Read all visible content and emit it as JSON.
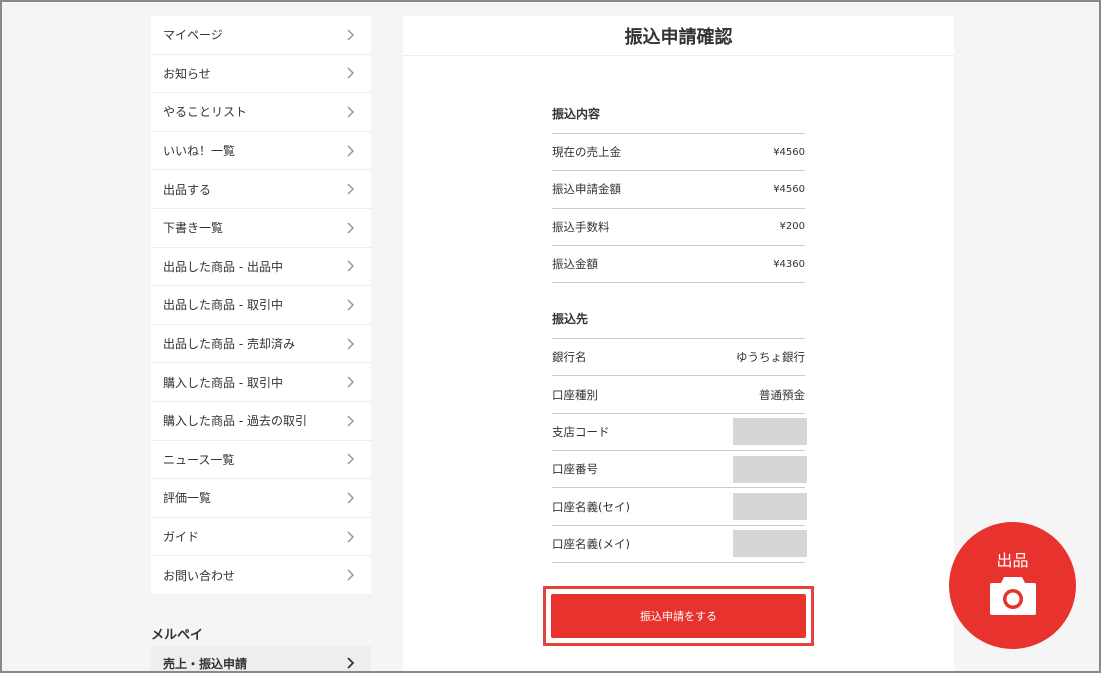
{
  "sidebar": {
    "items": [
      {
        "label": "マイページ"
      },
      {
        "label": "お知らせ"
      },
      {
        "label": "やることリスト"
      },
      {
        "label": "いいね！一覧"
      },
      {
        "label": "出品する"
      },
      {
        "label": "下書き一覧"
      },
      {
        "label": "出品した商品 - 出品中"
      },
      {
        "label": "出品した商品 - 取引中"
      },
      {
        "label": "出品した商品 - 売却済み"
      },
      {
        "label": "購入した商品 - 取引中"
      },
      {
        "label": "購入した商品 - 過去の取引"
      },
      {
        "label": "ニュース一覧"
      },
      {
        "label": "評価一覧"
      },
      {
        "label": "ガイド"
      },
      {
        "label": "お問い合わせ"
      }
    ],
    "section_title": "メルペイ",
    "active_item": "売上・振込申請"
  },
  "main": {
    "title": "振込申請確認",
    "transfer": {
      "heading": "振込内容",
      "rows": [
        {
          "label": "現在の売上金",
          "value": "¥4560"
        },
        {
          "label": "振込申請金額",
          "value": "¥4560"
        },
        {
          "label": "振込手数料",
          "value": "¥200"
        },
        {
          "label": "振込金額",
          "value": "¥4360"
        }
      ]
    },
    "destination": {
      "heading": "振込先",
      "bank_label": "銀行名",
      "bank_value": "ゆうちょ銀行",
      "account_type_label": "口座種別",
      "account_type_value": "普通預金",
      "branch_label": "支店コード",
      "account_number_label": "口座番号",
      "holder_kana_sei_label": "口座名義(セイ)",
      "holder_kana_mei_label": "口座名義(メイ)"
    },
    "submit_label": "振込申請をする"
  },
  "fab": {
    "label": "出品",
    "icon": "camera-icon"
  },
  "colors": {
    "accent": "#e8322d",
    "highlight_border": "#e8413d",
    "masked": "#d6d6d6"
  }
}
